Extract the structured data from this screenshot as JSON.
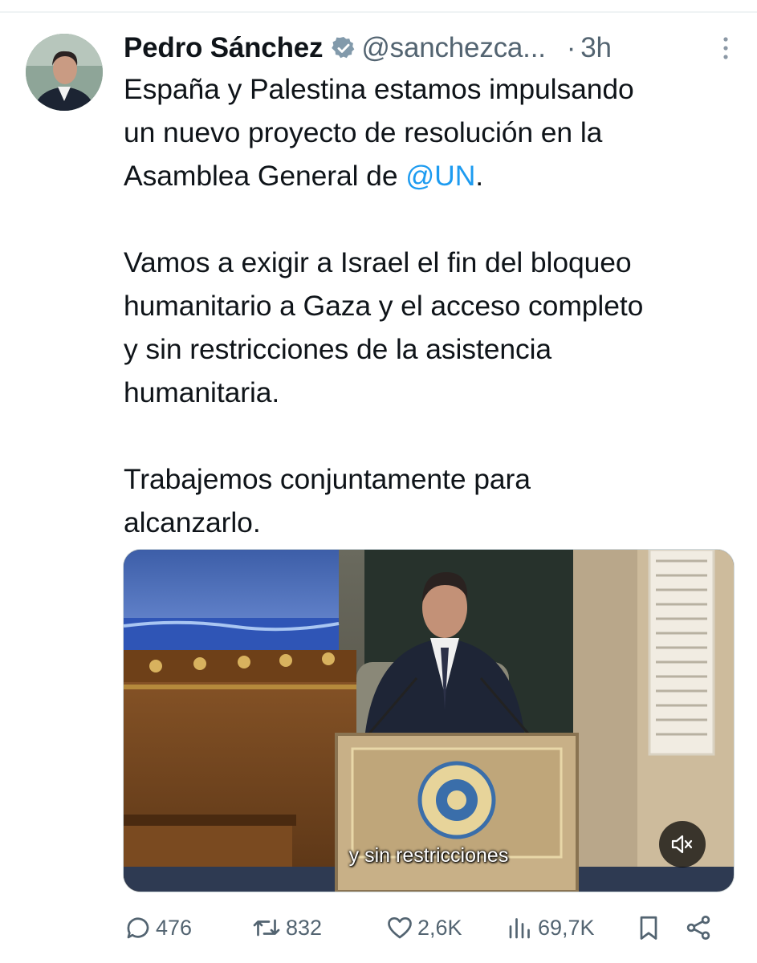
{
  "tweet": {
    "author_name": "Pedro Sánchez",
    "handle": "@sanchezca...",
    "separator": "·",
    "time": "3h",
    "paragraphs": [
      {
        "lines": [
          "España y Palestina estamos impulsando",
          "un nuevo proyecto de resolución en la"
        ],
        "last_line_prefix": "Asamblea General de ",
        "mention": "@UN",
        "last_line_suffix": "."
      },
      {
        "lines": [
          "Vamos a exigir a Israel el fin del bloqueo",
          "humanitario a Gaza y el acceso completo",
          "y sin restricciones de la asistencia",
          "humanitaria."
        ]
      },
      {
        "lines": [
          "Trabajemos conjuntamente para",
          "alcanzarlo."
        ]
      }
    ],
    "media": {
      "subtitle": "y sin restricciones",
      "mute_icon": "speaker-muted-icon"
    },
    "actions": {
      "replies": "476",
      "reposts": "832",
      "likes": "2,6K",
      "views": "69,7K"
    }
  },
  "colors": {
    "text": "#0f1419",
    "secondary": "#536471",
    "link": "#1d9bf0",
    "divider": "#eff3f4"
  }
}
